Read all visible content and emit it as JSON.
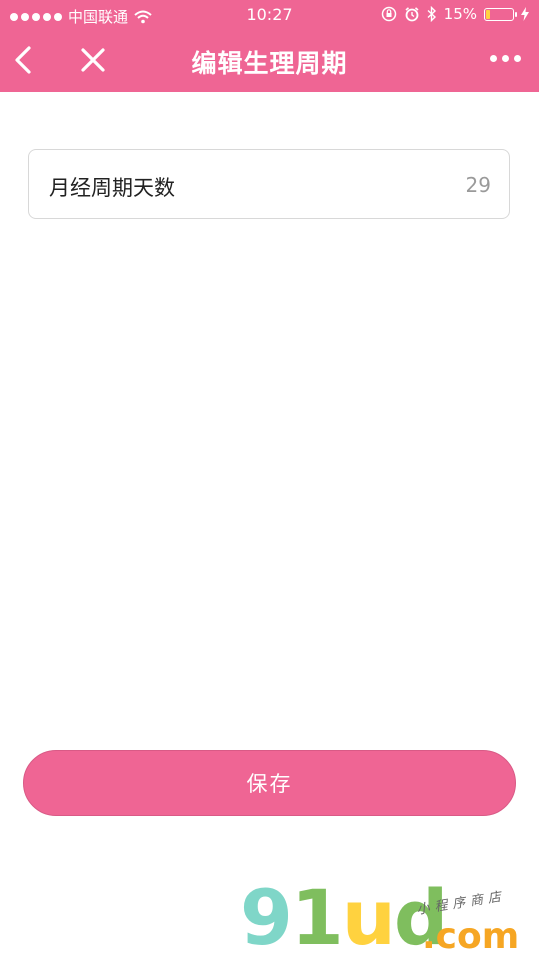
{
  "status_bar": {
    "carrier": "中国联通",
    "time": "10:27",
    "battery": "15%",
    "battery_level": 0.15
  },
  "nav": {
    "title": "编辑生理周期"
  },
  "field": {
    "label": "月经周期天数",
    "value": "29"
  },
  "save_label": "保存",
  "watermark": {
    "logo_parts": [
      "9",
      "1",
      "u",
      "d"
    ],
    "domain": ".com",
    "tagline": "小程序商店"
  },
  "colors": {
    "accent": "#ef6594",
    "battery": "#ffd23f"
  },
  "icons": {
    "back": "chevron-left-icon",
    "close": "close-icon",
    "more": "more-icon",
    "wifi": "wifi-icon",
    "lock_rotation": "rotation-lock-icon",
    "alarm": "alarm-icon",
    "bluetooth": "bluetooth-icon",
    "charging": "charging-bolt-icon"
  }
}
